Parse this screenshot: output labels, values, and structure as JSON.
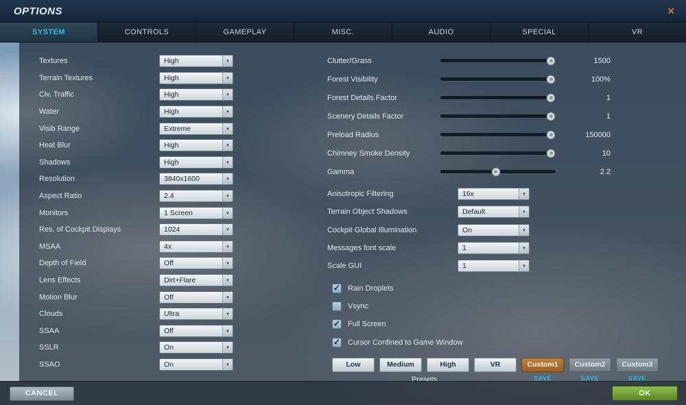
{
  "window": {
    "title": "OPTIONS",
    "close_icon": "✕"
  },
  "tabs": [
    {
      "label": "SYSTEM",
      "active": true
    },
    {
      "label": "CONTROLS",
      "active": false
    },
    {
      "label": "GAMEPLAY",
      "active": false
    },
    {
      "label": "MISC.",
      "active": false
    },
    {
      "label": "AUDIO",
      "active": false
    },
    {
      "label": "SPECIAL",
      "active": false
    },
    {
      "label": "VR",
      "active": false
    }
  ],
  "left_settings": [
    {
      "label": "Textures",
      "value": "High"
    },
    {
      "label": "Terrain Textures",
      "value": "High"
    },
    {
      "label": "Civ. Traffic",
      "value": "High"
    },
    {
      "label": "Water",
      "value": "High"
    },
    {
      "label": "Visib Range",
      "value": "Extreme"
    },
    {
      "label": "Heat Blur",
      "value": "High"
    },
    {
      "label": "Shadows",
      "value": "High"
    },
    {
      "label": "Resolution",
      "value": "3840x1600"
    },
    {
      "label": "Aspect Ratio",
      "value": "2.4"
    },
    {
      "label": "Monitors",
      "value": "1 Screen"
    },
    {
      "label": "Res. of Cockpit Displays",
      "value": "1024"
    },
    {
      "label": "MSAA",
      "value": "4x"
    },
    {
      "label": "Depth of Field",
      "value": "Off"
    },
    {
      "label": "Lens Effects",
      "value": "Dirt+Flare"
    },
    {
      "label": "Motion Blur",
      "value": "Off"
    },
    {
      "label": "Clouds",
      "value": "Ultra"
    },
    {
      "label": "SSAA",
      "value": "Off"
    },
    {
      "label": "SSLR",
      "value": "On"
    },
    {
      "label": "SSAO",
      "value": "On"
    }
  ],
  "sliders": [
    {
      "label": "Clutter/Grass",
      "value": "1500",
      "percent": 96
    },
    {
      "label": "Forest Visibility",
      "value": "100%",
      "percent": 96
    },
    {
      "label": "Forest Details Factor",
      "value": "1",
      "percent": 96
    },
    {
      "label": "Scenery Details Factor",
      "value": "1",
      "percent": 96
    },
    {
      "label": "Preload Radius",
      "value": "150000",
      "percent": 96
    },
    {
      "label": "Chimney Smoke Density",
      "value": "10",
      "percent": 96
    },
    {
      "label": "Gamma",
      "value": "2.2",
      "percent": 48
    }
  ],
  "right_settings": [
    {
      "label": "Anisotropic Filtering",
      "value": "16x"
    },
    {
      "label": "Terrain Object Shadows",
      "value": "Default"
    },
    {
      "label": "Cockpit Global Illumination",
      "value": "On"
    },
    {
      "label": "Messages font scale",
      "value": "1"
    },
    {
      "label": "Scale GUI",
      "value": "1"
    }
  ],
  "checkboxes": [
    {
      "label": "Rain Droplets",
      "checked": true
    },
    {
      "label": "Vsync",
      "checked": false
    },
    {
      "label": "Full Screen",
      "checked": true
    },
    {
      "label": "Cursor Confined to Game Window",
      "checked": true
    }
  ],
  "presets": {
    "caption": "Presets",
    "buttons": [
      {
        "label": "Low",
        "style": "light"
      },
      {
        "label": "Medium",
        "style": "light"
      },
      {
        "label": "High",
        "style": "light"
      },
      {
        "label": "VR",
        "style": "light"
      },
      {
        "label": "Custom1",
        "style": "active",
        "save": "SAVE"
      },
      {
        "label": "Custom2",
        "style": "dark",
        "save": "SAVE"
      },
      {
        "label": "Custom3",
        "style": "dark",
        "save": "SAVE"
      }
    ]
  },
  "footer": {
    "cancel_label": "CANCEL",
    "ok_label": "OK"
  }
}
